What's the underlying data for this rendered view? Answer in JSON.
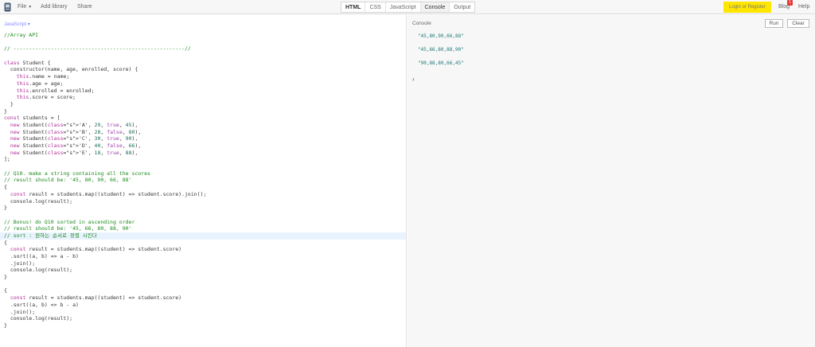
{
  "menu": {
    "file": "File",
    "add_library": "Add library",
    "share": "Share"
  },
  "tabs": [
    "HTML",
    "CSS",
    "JavaScript",
    "Console",
    "Output"
  ],
  "header_right": {
    "login": "Login or Register",
    "blog": "Blog",
    "badge": "1",
    "help": "Help"
  },
  "editor": {
    "language": "JavaScript",
    "code_lines": [
      "//Array API",
      "",
      "// -------------------------------------------------------//",
      "",
      "class Student {",
      "  constructor(name, age, enrolled, score) {",
      "    this.name = name;",
      "    this.age = age;",
      "    this.enrolled = enrolled;",
      "    this.score = score;",
      "  }",
      "}",
      "const students = [",
      "  new Student('A', 29, true, 45),",
      "  new Student('B', 28, false, 80),",
      "  new Student('C', 30, true, 90),",
      "  new Student('D', 40, false, 66),",
      "  new Student('E', 18, true, 88),",
      "];",
      "",
      "// Q10. make a string containing all the scores",
      "// result should be: '45, 80, 90, 66, 88'",
      "{",
      "  const result = students.map((student) => student.score).join();",
      "  console.log(result);",
      "}",
      "",
      "// Bonus! do Q10 sorted in ascending order",
      "// result should be: '45, 66, 80, 88, 90'",
      "// sort : 원하는 순서로 정렬 시킨다",
      "{",
      "  const result = students.map((student) => student.score)",
      "  .sort((a, b) => a - b)",
      "  .join();",
      "  console.log(result);",
      "}",
      "",
      "{",
      "  const result = students.map((student) => student.score)",
      "  .sort((a, b) => b - a)",
      "  .join();",
      "  console.log(result);",
      "}"
    ]
  },
  "console": {
    "title": "Console",
    "run": "Run",
    "clear": "Clear",
    "outputs": [
      "\"45,80,90,66,88\"",
      "\"45,66,80,88,90\"",
      "\"90,88,80,66,45\""
    ],
    "prompt": "›"
  }
}
